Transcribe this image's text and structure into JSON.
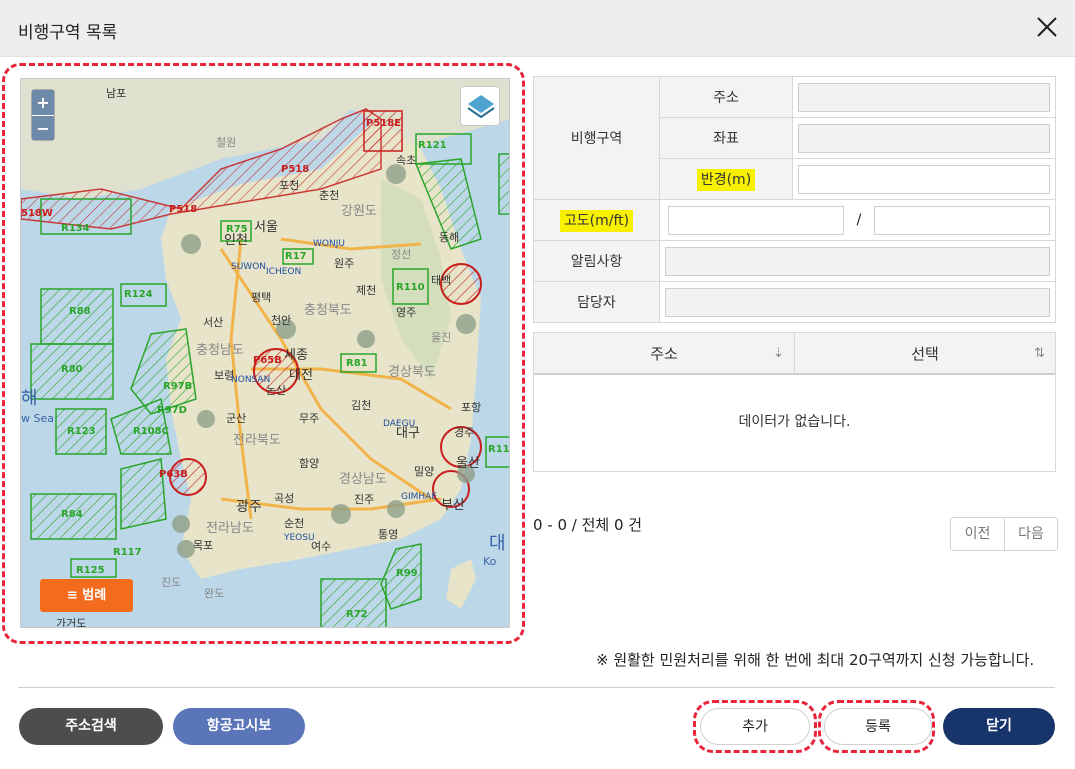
{
  "header": {
    "title": "비행구역 목록"
  },
  "map": {
    "zoom_in": "+",
    "zoom_out": "−",
    "legend_label": "≡ 범례",
    "zones": [
      {
        "id": "P518E",
        "color": "#c81e1e"
      },
      {
        "id": "R121",
        "color": "#2aa52a"
      },
      {
        "id": "P518",
        "color": "#c81e1e"
      },
      {
        "id": "P518",
        "color": "#c81e1e"
      },
      {
        "id": "518W",
        "color": "#c81e1e"
      },
      {
        "id": "R134",
        "color": "#2aa52a"
      },
      {
        "id": "R75",
        "color": "#2aa52a"
      },
      {
        "id": "R17",
        "color": "#2aa52a"
      },
      {
        "id": "R110",
        "color": "#2aa52a"
      },
      {
        "id": "R124",
        "color": "#2aa52a"
      },
      {
        "id": "R88",
        "color": "#2aa52a"
      },
      {
        "id": "R80",
        "color": "#2aa52a"
      },
      {
        "id": "R97B",
        "color": "#2aa52a"
      },
      {
        "id": "R97D",
        "color": "#2aa52a"
      },
      {
        "id": "R123",
        "color": "#2aa52a"
      },
      {
        "id": "R108C",
        "color": "#2aa52a"
      },
      {
        "id": "P65B",
        "color": "#c81e1e"
      },
      {
        "id": "R81",
        "color": "#2aa52a"
      },
      {
        "id": "P63B",
        "color": "#c81e1e"
      },
      {
        "id": "R84",
        "color": "#2aa52a"
      },
      {
        "id": "R117",
        "color": "#2aa52a"
      },
      {
        "id": "R125",
        "color": "#2aa52a"
      },
      {
        "id": "R99",
        "color": "#2aa52a"
      },
      {
        "id": "R72",
        "color": "#2aa52a"
      },
      {
        "id": "R11",
        "color": "#2aa52a"
      }
    ],
    "places": [
      "남포",
      "철원",
      "포천",
      "춘천",
      "강원도",
      "동해",
      "서울",
      "인천",
      "WONJU",
      "원주",
      "SUWON",
      "ICHEON",
      "평택",
      "제천",
      "영주",
      "천안",
      "서산",
      "충청북도",
      "충청남도",
      "세종",
      "대전",
      "보령",
      "NONSAN",
      "논산",
      "경상북도",
      "김천",
      "포항",
      "군산",
      "DAEGU",
      "대구",
      "경주",
      "전라북도",
      "무주",
      "함양",
      "울산",
      "밀양",
      "경상남도",
      "부산",
      "광주",
      "곡성",
      "진주",
      "김해",
      "전라남도",
      "순천",
      "통영",
      "목포",
      "YEOSU",
      "여수",
      "진도",
      "완도",
      "가거도",
      "태백",
      "정선",
      "울진",
      "속초",
      "대",
      "해",
      "Sea",
      "Ko"
    ]
  },
  "form": {
    "zone_label": "비행구역",
    "address_label": "주소",
    "coord_label": "좌표",
    "radius_label": "반경(m)",
    "altitude_label": "고도(m/ft)",
    "altitude_sep": "/",
    "notice_label": "알림사항",
    "manager_label": "담당자",
    "address_value": "",
    "coord_value": "",
    "radius_value": "",
    "alt_m_value": "",
    "alt_ft_value": "",
    "notice_value": "",
    "manager_value": ""
  },
  "results": {
    "columns": [
      "주소",
      "선택"
    ],
    "empty_text": "데이터가 없습니다."
  },
  "pager": {
    "summary": "0 - 0 / 전체 0 건",
    "prev": "이전",
    "next": "다음"
  },
  "notice_text": "※ 원활한 민원처리를 위해 한 번에 최대 20구역까지 신청 가능합니다.",
  "buttons": {
    "address_search": "주소검색",
    "aero_notice": "항공고시보",
    "add": "추가",
    "register": "등록",
    "close": "닫기"
  },
  "colors": {
    "highlight": "#f7f100",
    "close_button": "#17356b",
    "notam_button": "#5b76b8",
    "legend": "#f36b1c",
    "annotation": "#e8253a"
  }
}
